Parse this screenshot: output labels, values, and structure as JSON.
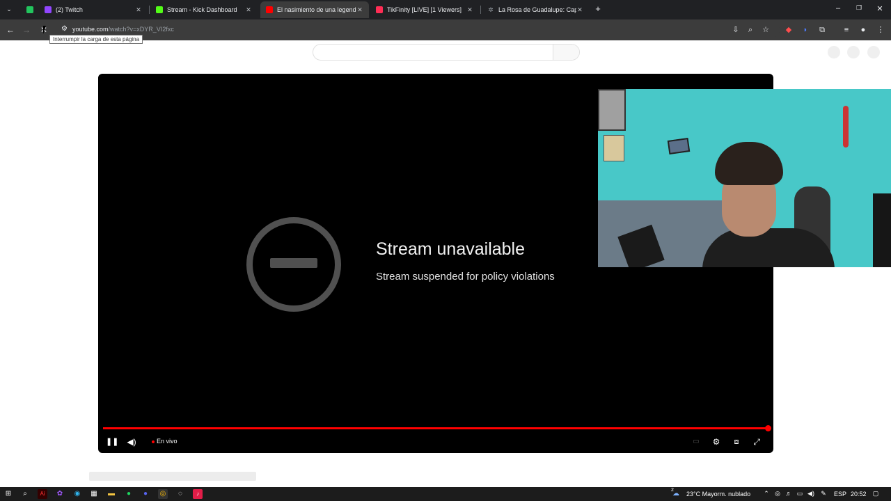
{
  "browser": {
    "tabs": [
      {
        "title": "",
        "favicon": "site-favicon",
        "color": "#22c55e"
      },
      {
        "title": "(2) Twitch",
        "favicon": "twitch-icon",
        "color": "#9146ff"
      },
      {
        "title": "Stream - Kick Dashboard",
        "favicon": "kick-icon",
        "color": "#53fc18"
      },
      {
        "title": "El nasimiento de una legenda -",
        "favicon": "youtube-icon",
        "color": "#ff0000"
      },
      {
        "title": "TikFinity [LIVE] [1 Viewers]",
        "favicon": "tikfinity-icon",
        "color": "#ff2d55"
      },
      {
        "title": "La Rosa de Guadalupe: Capítulo",
        "favicon": "star-icon",
        "color": "#9aa0a6"
      }
    ],
    "close_glyph": "✕",
    "new_tab_glyph": "+",
    "url_host": "youtube.com",
    "url_path": "/watch?v=xDYR_VI2fxc",
    "tooltip": "Interrumpir la carga de esta página"
  },
  "player": {
    "error_title": "Stream unavailable",
    "error_subtitle": "Stream suspended for policy violations",
    "live_label": "En vivo",
    "progress": 1.0,
    "accent": "#ff0000"
  },
  "taskbar": {
    "weather_badge": "2",
    "weather": "23°C  Mayorm. nublado",
    "language": "ESP",
    "time": "20:52"
  }
}
